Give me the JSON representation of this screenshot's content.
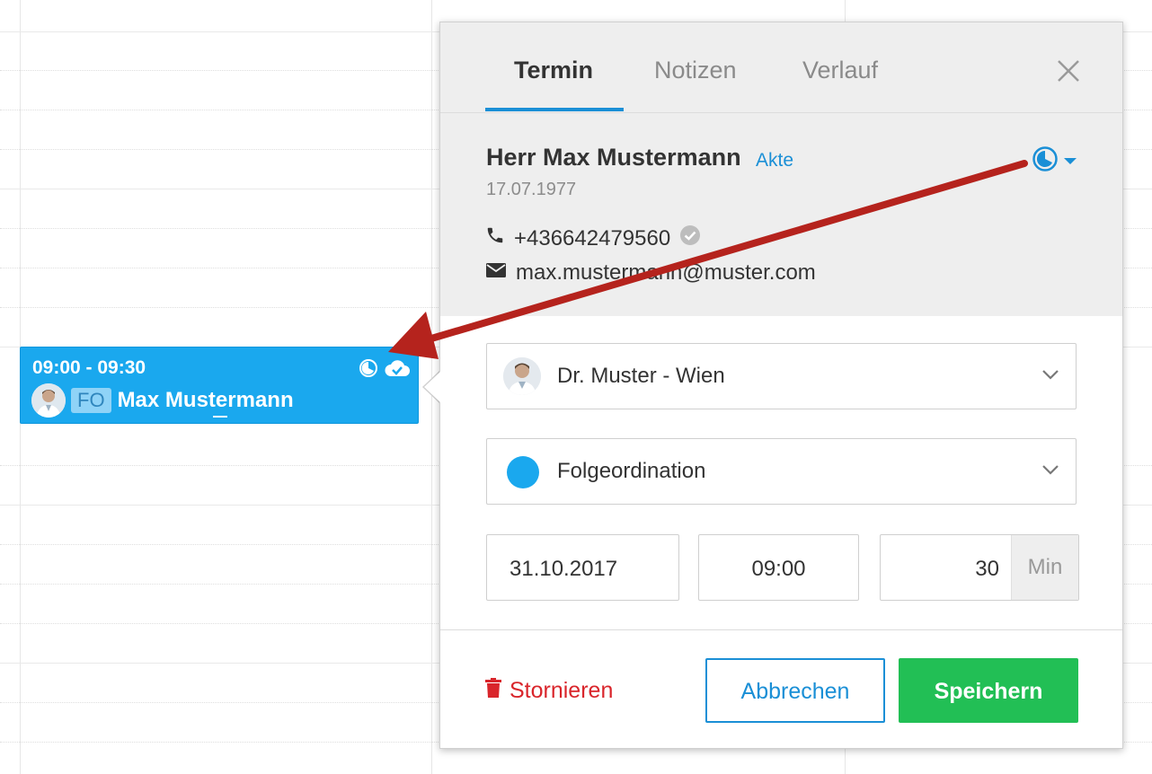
{
  "appointment": {
    "time": "09:00 - 09:30",
    "badge": "FO",
    "name": "Max Mustermann",
    "color": "#1aa8ee"
  },
  "popover": {
    "tabs": [
      {
        "label": "Termin",
        "active": true
      },
      {
        "label": "Notizen",
        "active": false
      },
      {
        "label": "Verlauf",
        "active": false
      }
    ],
    "patient": {
      "name": "Herr Max Mustermann",
      "record_link": "Akte",
      "birthdate": "17.07.1977",
      "phone": "+436642479560",
      "email": "max.mustermann@muster.com"
    },
    "practitioner": "Dr. Muster - Wien",
    "appointment_type": "Folgeordination",
    "appointment_type_color": "#1aa8ee",
    "date": "31.10.2017",
    "time": "09:00",
    "duration": "30",
    "duration_unit": "Min",
    "actions": {
      "cancel_label": "Stornieren",
      "abort_label": "Abbrechen",
      "save_label": "Speichern"
    }
  },
  "colors": {
    "accent": "#1a8fd6",
    "danger": "#d9252b",
    "success": "#22bf55",
    "annotation_arrow": "#b5231d"
  },
  "icons": [
    "status-clock-icon",
    "cloud-check-icon",
    "close-icon",
    "phone-icon",
    "verified-check-icon",
    "mail-icon",
    "chevron-down-icon",
    "trash-icon"
  ]
}
